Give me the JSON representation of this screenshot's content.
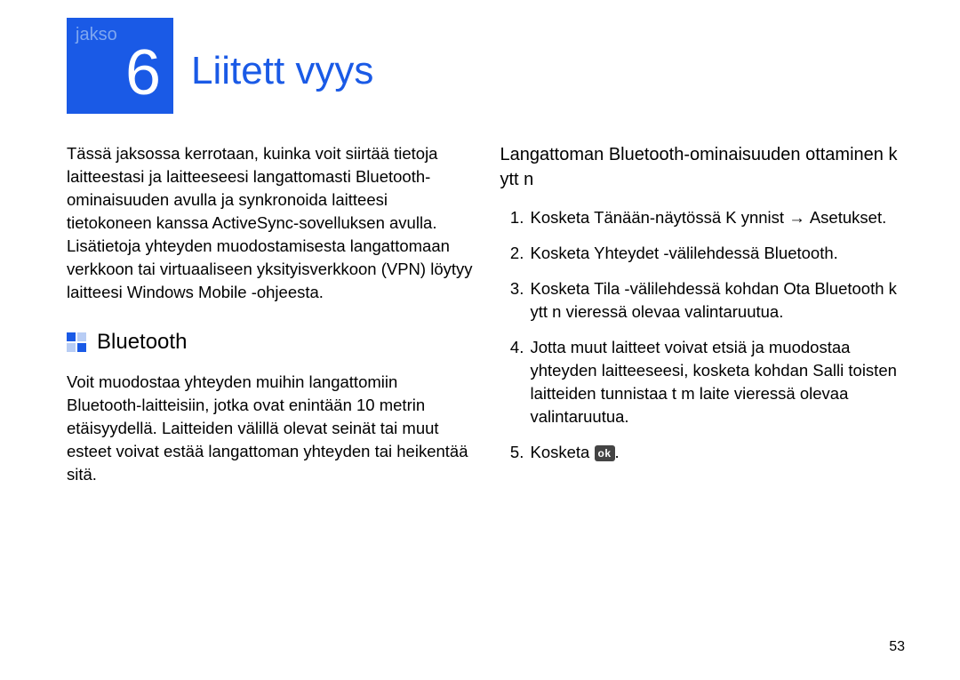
{
  "chapter": {
    "label": "jakso",
    "number": "6",
    "title": "Liitett vyys"
  },
  "left": {
    "intro": "Tässä jaksossa kerrotaan, kuinka voit siirtää tietoja laitteestasi ja laitteeseesi langattomasti Bluetooth-ominaisuuden avulla ja synkronoida laitteesi tietokoneen kanssa ActiveSync-sovelluksen avulla. Lisätietoja yhteyden muodostamisesta langattomaan verkkoon tai virtuaaliseen yksityisverkkoon (VPN) löytyy laitteesi Windows Mobile -ohjeesta.",
    "bluetooth_heading": "Bluetooth",
    "bluetooth_body": "Voit muodostaa yhteyden muihin langattomiin Bluetooth-laitteisiin, jotka ovat enintään 10 metrin etäisyydellä. Laitteiden välillä olevat seinät tai muut esteet voivat estää langattoman yhteyden tai heikentää sitä."
  },
  "right": {
    "subheading": "Langattoman Bluetooth-ominaisuuden ottaminen k ytt  n",
    "steps": {
      "s1_a": "Kosketa Tänään-näytössä ",
      "s1_b": "K ynnist",
      "s1_c": " → ",
      "s1_d": "Asetukset",
      "s1_e": ".",
      "s2_a": "Kosketa ",
      "s2_b": "Yhteydet",
      "s2_c": " -välilehdessä ",
      "s2_d": "Bluetooth",
      "s2_e": ".",
      "s3_a": "Kosketa ",
      "s3_b": "Tila",
      "s3_c": " -välilehdessä kohdan ",
      "s3_d": "Ota Bluetooth k ytt  n",
      "s3_e": " vieressä olevaa valintaruutua.",
      "s4_a": "Jotta muut laitteet voivat etsiä ja muodostaa yhteyden laitteeseesi, kosketa kohdan ",
      "s4_b": "Salli toisten laitteiden tunnistaa t m  laite",
      "s4_c": " vieressä olevaa valintaruutua.",
      "s5_a": "Kosketa ",
      "s5_ok": "ok",
      "s5_b": "."
    }
  },
  "page_number": "53"
}
